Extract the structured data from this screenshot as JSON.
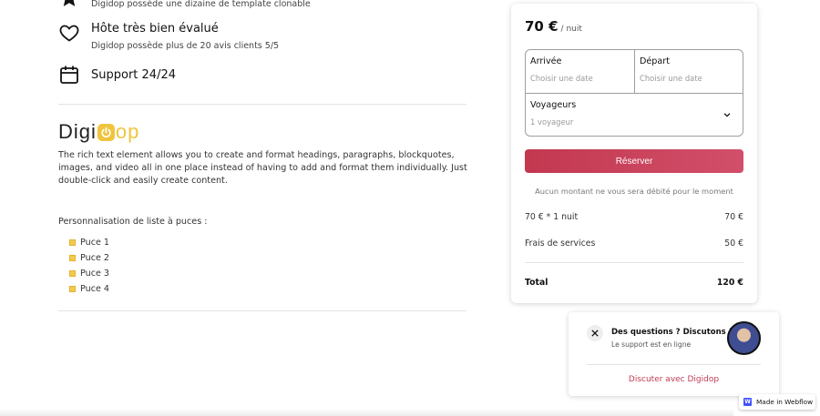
{
  "features": [
    {
      "icon": "star-icon",
      "title": "",
      "desc": "Digidop possède une dizaine de template clonable"
    },
    {
      "icon": "heart-icon",
      "title": "Hôte très bien évalué",
      "desc": "Digidop possède plus de 20 avis clients 5/5"
    },
    {
      "icon": "calendar-icon",
      "title": "Support 24/24",
      "desc": ""
    }
  ],
  "logo": {
    "text_start": "Digi",
    "text_end": "op",
    "accent": "#f0c53e"
  },
  "richtext": "The rich text element allows you to create and format headings, paragraphs, blockquotes, images, and video all in one place instead of having to add and format them individually. Just double-click and easily create content.",
  "list": {
    "label": "Personnalisation de liste à puces :",
    "items": [
      "Puce 1",
      "Puce 2",
      "Puce 3",
      "Puce 4"
    ]
  },
  "booking": {
    "price": "70 €",
    "per": "/ nuit",
    "arrival_label": "Arrivée",
    "arrival_placeholder": "Choisir une date",
    "departure_label": "Départ",
    "departure_placeholder": "Choisir une date",
    "guests_label": "Voyageurs",
    "guests_value": "1 voyageur",
    "reserve_label": "Réserver",
    "notice": "Aucun montant ne vous sera débité pour le moment",
    "lines": [
      {
        "label": "70 € * 1 nuit",
        "amount": "70 €"
      },
      {
        "label": "Frais de services",
        "amount": "50 €"
      }
    ],
    "total_label": "Total",
    "total_amount": "120 €",
    "accent": "#c2384f"
  },
  "chat": {
    "title": "Des questions ? Discutons !",
    "status": "Le support est en ligne",
    "link": "Discuter avec Digidop"
  },
  "badge": {
    "text": "Made in Webflow",
    "logo": "W"
  }
}
